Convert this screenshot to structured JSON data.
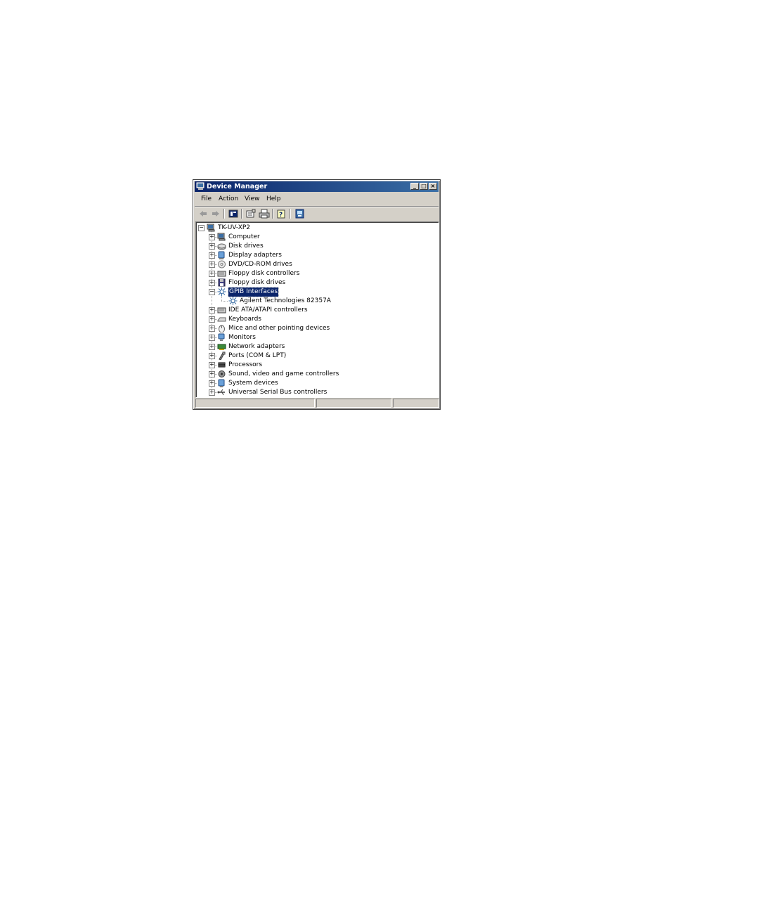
{
  "window": {
    "title": "Device Manager",
    "controls": {
      "minimize": "_",
      "maximize": "□",
      "close": "×"
    }
  },
  "menu": [
    {
      "label": "File"
    },
    {
      "label": "Action"
    },
    {
      "label": "View"
    },
    {
      "label": "Help"
    }
  ],
  "toolbar": [
    {
      "name": "back-button",
      "icon": "back-arrow-icon"
    },
    {
      "name": "forward-button",
      "icon": "forward-arrow-icon"
    },
    {
      "name": "show-hide-console-tree-button",
      "icon": "console-tree-icon"
    },
    {
      "name": "properties-button",
      "icon": "properties-icon"
    },
    {
      "name": "print-button",
      "icon": "printer-icon"
    },
    {
      "name": "help-button",
      "icon": "help-icon"
    },
    {
      "name": "scan-hardware-button",
      "icon": "scan-hardware-icon"
    }
  ],
  "tree": {
    "root": {
      "label": "TK-UV-XP2",
      "icon": "computer-icon",
      "expanded": true
    },
    "items": [
      {
        "label": "Computer",
        "icon": "computer-icon",
        "expanded": false
      },
      {
        "label": "Disk drives",
        "icon": "disk-drive-icon",
        "expanded": false
      },
      {
        "label": "Display adapters",
        "icon": "display-adapter-icon",
        "expanded": false
      },
      {
        "label": "DVD/CD-ROM drives",
        "icon": "cdrom-icon",
        "expanded": false
      },
      {
        "label": "Floppy disk controllers",
        "icon": "controller-icon",
        "expanded": false
      },
      {
        "label": "Floppy disk drives",
        "icon": "floppy-icon",
        "expanded": false
      },
      {
        "label": "GPIB Interfaces",
        "icon": "gpib-icon",
        "expanded": true,
        "selected": true,
        "children": [
          {
            "label": "Agilent Technologies 82357A",
            "icon": "gpib-icon"
          }
        ]
      },
      {
        "label": "IDE ATA/ATAPI controllers",
        "icon": "controller-icon",
        "expanded": false
      },
      {
        "label": "Keyboards",
        "icon": "keyboard-icon",
        "expanded": false
      },
      {
        "label": "Mice and other pointing devices",
        "icon": "mouse-icon",
        "expanded": false
      },
      {
        "label": "Monitors",
        "icon": "monitor-icon",
        "expanded": false
      },
      {
        "label": "Network adapters",
        "icon": "network-adapter-icon",
        "expanded": false
      },
      {
        "label": "Ports (COM & LPT)",
        "icon": "port-icon",
        "expanded": false
      },
      {
        "label": "Processors",
        "icon": "processor-icon",
        "expanded": false
      },
      {
        "label": "Sound, video and game controllers",
        "icon": "sound-icon",
        "expanded": false
      },
      {
        "label": "System devices",
        "icon": "system-device-icon",
        "expanded": false
      },
      {
        "label": "Universal Serial Bus controllers",
        "icon": "usb-icon",
        "expanded": false
      }
    ]
  },
  "colors": {
    "titlebar_start": "#0a246a",
    "titlebar_end": "#3a6ea5",
    "face": "#d4d0c8",
    "selection": "#0a246a"
  }
}
